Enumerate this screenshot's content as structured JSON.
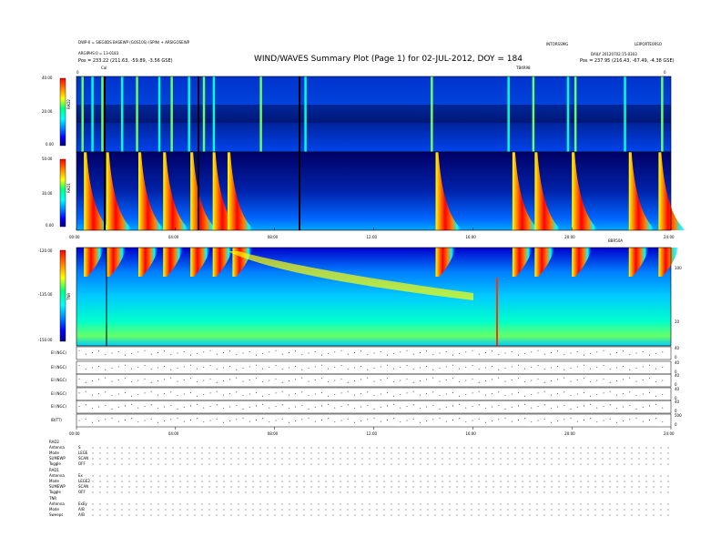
{
  "header": {
    "title": "WIND/WAVES Summary Plot (Page 1) for 02-JUL-2012, DOY = 184",
    "left_line1": "DWP-0 = SIEG0DS BASEWP (GOS10S) (SPIN) + ARSIGOSEWP",
    "left_line2": "ARGIPHS:0 = 13-0183",
    "left_pos": "Pos =  233.22 (211.63, -59.89, -3.56 GSE)",
    "right_line1": "INTORSSMG",
    "right_line2": "LEIPORTE0RSO",
    "right_line3": "DAILY 20120702:15-0303",
    "right_pos": "Pos =  237.95 (216.43, -67.49, -4.38 GSE)",
    "cal_label": "Cal",
    "marker_top_left": "0",
    "marker_top_right": "0",
    "tb_label": "TB4R98"
  },
  "panels": {
    "rad2": {
      "label": "RAD2",
      "ticks": [
        "40.00",
        "20.00",
        "0.00"
      ]
    },
    "rad1": {
      "label": "RAD1",
      "ticks": [
        "50.00",
        "30.00",
        "0.00"
      ]
    },
    "tnr": {
      "label": "TNR",
      "ticks": [
        "-120.00",
        "-135.00",
        "-150.00"
      ],
      "right_ticks": [
        "100",
        "10"
      ],
      "corner_label": "BBR50A"
    },
    "time_ticks": [
      "00:00",
      "04:00",
      "08:00",
      "12:00",
      "16:00",
      "20:00",
      "24:00"
    ]
  },
  "stack": {
    "rows": [
      "EI (NGC)",
      "EI (NGC)",
      "EI (NGC)",
      "EI (NGC)",
      "EI (NGC)",
      "IB(TT)"
    ],
    "right_ticks": [
      "40",
      "0",
      "40",
      "0",
      "40",
      "0",
      "40",
      "0",
      "40",
      "0",
      "500",
      "0"
    ],
    "time_ticks": [
      "00:00",
      "04:00",
      "08:00",
      "12:00",
      "16:00",
      "20:00",
      "24:00"
    ]
  },
  "legend": {
    "groups": [
      {
        "name": "RAD2",
        "rows": [
          [
            "Antenna",
            "S"
          ],
          [
            "Mode",
            "LEGE"
          ],
          [
            "SUMEWP",
            "SCAN"
          ],
          [
            "Toggle",
            "OFF"
          ]
        ]
      },
      {
        "name": "RAD1",
        "rows": [
          [
            "Antenna",
            "Ex"
          ],
          [
            "Mode",
            "LEGE2"
          ],
          [
            "SUMEWP",
            "SCAN"
          ],
          [
            "Toggle",
            "OFF"
          ]
        ]
      },
      {
        "name": "TNR",
        "rows": [
          [
            "Antenna",
            "ExEy"
          ],
          [
            "Mode",
            "A/B"
          ],
          [
            "Sweeps",
            "A/B"
          ]
        ]
      }
    ]
  },
  "chart_data": [
    {
      "type": "heatmap",
      "name_hint": "rad2",
      "ylabel": "RAD2",
      "ylim": [
        0,
        40
      ],
      "xlim_hours": [
        0,
        24
      ],
      "burst_hours": [
        0.2,
        0.6,
        1.0,
        1.8,
        2.4,
        3.3,
        3.8,
        4.5,
        5.1,
        5.5,
        7.4,
        9.2,
        14.3,
        17.4,
        18.4,
        19.8,
        20.1,
        22.1,
        23.6
      ]
    },
    {
      "type": "heatmap",
      "name_hint": "rad1",
      "ylabel": "RAD1",
      "ylim": [
        0,
        50
      ],
      "xlim_hours": [
        0,
        24
      ],
      "burst_hours": [
        0.3,
        1.2,
        2.5,
        3.5,
        4.6,
        5.5,
        6.1,
        14.5,
        17.6,
        18.5,
        20.0,
        22.3,
        23.5
      ]
    },
    {
      "type": "heatmap",
      "name_hint": "tnr",
      "ylabel": "TNR",
      "ylim": [
        -150,
        -120
      ],
      "xlim_hours": [
        0,
        24
      ],
      "burst_hours": [
        0.3,
        1.2,
        2.5,
        3.5,
        4.6,
        5.5,
        6.3,
        14.5,
        17.6,
        18.5,
        20.0,
        22.3,
        23.5
      ]
    }
  ],
  "colors": {
    "cbar": [
      "#ff0000",
      "#ff7f00",
      "#ffff00",
      "#00ff7f",
      "#00ffff",
      "#007fff",
      "#0000ff",
      "#00007f",
      "#000000"
    ]
  }
}
